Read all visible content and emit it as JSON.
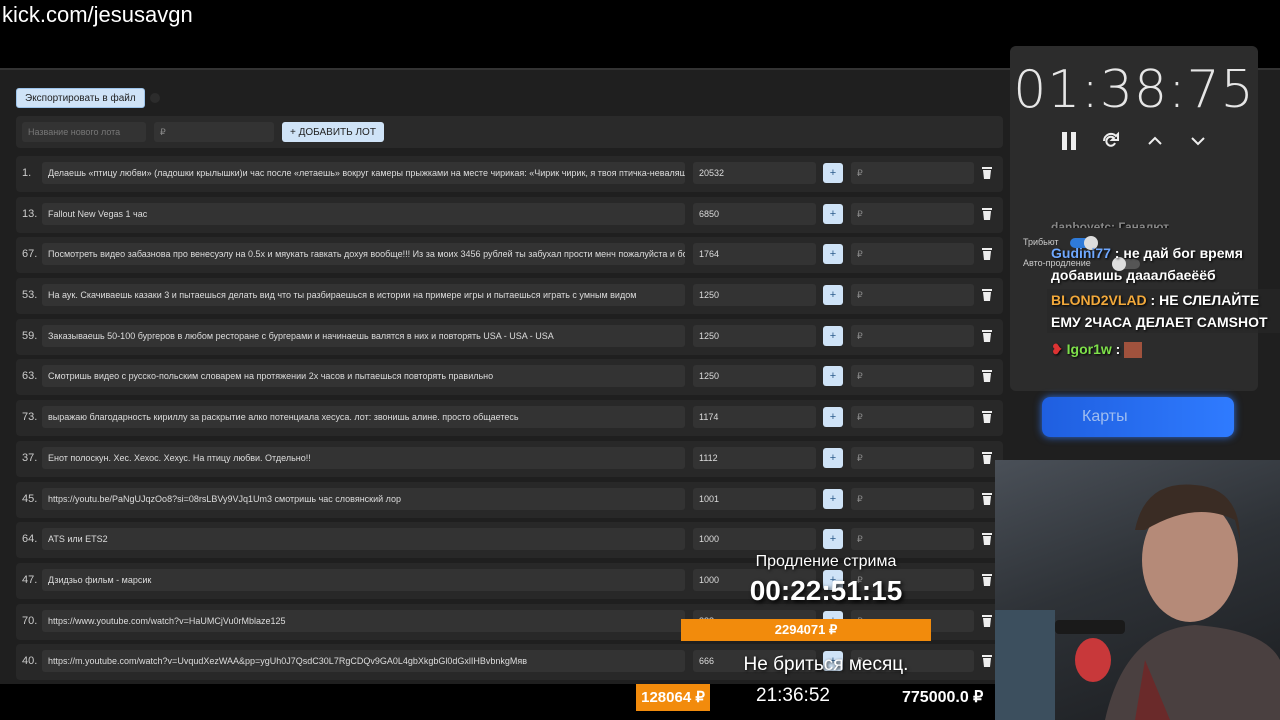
{
  "browser": {
    "url": "kick.com/jesusavgn"
  },
  "toolbar": {
    "export_label": "Экспортировать в файл"
  },
  "add_lot": {
    "name_placeholder": "Название нового лота",
    "price_placeholder": "₽",
    "add_label": "+ ДОБАВИТЬ ЛОТ"
  },
  "lots": [
    {
      "num": "1.",
      "name": "Делаешь «птицу любви» (ладошки крылышки)и час после «летаешь» вокруг камеры прыжками на месте чирикая: «Чирик чирик, я твоя птичка-неваляшка",
      "amount": "20532",
      "plus": "+",
      "rub": "₽"
    },
    {
      "num": "13.",
      "name": "Fallout New Vegas 1 час",
      "amount": "6850",
      "plus": "+",
      "rub": "₽"
    },
    {
      "num": "67.",
      "name": "Посмотреть видео забазнова про венесуэлу на 0.5x и мяукать гавкать дохуя вообще!!! Из за моих 3456 рублей ты забухал прости менч пожалуйста и бо",
      "amount": "1764",
      "plus": "+",
      "rub": "₽"
    },
    {
      "num": "53.",
      "name": "На аук. Скачиваешь казаки 3 и пытаешься делать вид что ты разбираешься в истории на примере игры и пытаешься играть с умным видом",
      "amount": "1250",
      "plus": "+",
      "rub": "₽"
    },
    {
      "num": "59.",
      "name": "Заказываешь 50-100 бургеров в любом ресторане с бургерами и начинаешь валятся в них и повторять USA - USA - USA",
      "amount": "1250",
      "plus": "+",
      "rub": "₽"
    },
    {
      "num": "63.",
      "name": "Смотришь видео с русско-польским словарем на протяжении 2х часов и пытаешься повторять правильно",
      "amount": "1250",
      "plus": "+",
      "rub": "₽"
    },
    {
      "num": "73.",
      "name": "выражаю благодарность кириллу за раскрытие алко потенциала хесуса. лот: звонишь алине. просто общаетесь",
      "amount": "1174",
      "plus": "+",
      "rub": "₽"
    },
    {
      "num": "37.",
      "name": "Енот полоскун. Хес. Хехос. Хехус. На птицу любви. Отдельно!!",
      "amount": "1112",
      "plus": "+",
      "rub": "₽"
    },
    {
      "num": "45.",
      "name": "https://youtu.be/PaNgUJqzOo8?si=08rsLBVy9VJq1Um3 смотришь час словянский лор",
      "amount": "1001",
      "plus": "+",
      "rub": "₽"
    },
    {
      "num": "64.",
      "name": "ATS или ETS2",
      "amount": "1000",
      "plus": "+",
      "rub": "₽"
    },
    {
      "num": "47.",
      "name": "Дзидзьо фильм - марсик",
      "amount": "1000",
      "plus": "+",
      "rub": "₽"
    },
    {
      "num": "70.",
      "name": "https://www.youtube.com/watch?v=HaUMCjVu0rMblaze125",
      "amount": "888",
      "plus": "+",
      "rub": "₽"
    },
    {
      "num": "40.",
      "name": "https://m.youtube.com/watch?v=UvqudXezWAA&pp=ygUh0J7QsdC30L7RgCDQv9GA0L4gbXkgbGl0dGxlIHBvbnkgMяв",
      "amount": "666",
      "plus": "+",
      "rub": "₽"
    }
  ],
  "timer": {
    "value": "01:38:75"
  },
  "toggles": {
    "tribute_label": "Трибьют",
    "auto_label": "Авто-продление"
  },
  "chat": {
    "top_partial": "danboyetc: Ганалют",
    "messages": [
      {
        "user": "Gudini77",
        "text": "не дай бог время добавишь даaалбаеёёб",
        "color": "#6fa8ff"
      },
      {
        "user": "BLOND2VLAD",
        "text": "НЕ СЛЕЛАЙТЕ ЕМУ 2ЧАСА ДЕЛАЕТ CAMSHOT",
        "color": "#f2a93b"
      },
      {
        "user": "Igor1w",
        "text": "",
        "color": "#7ee04a"
      }
    ]
  },
  "cards_button": {
    "label": "Карты"
  },
  "overlay": {
    "extension_label": "Продление стрима",
    "extension_timer": "00:22:51:15",
    "goal": "2294071 ₽",
    "subtitle": "Не бриться месяц.",
    "bottom_amount": "128064 ₽",
    "bottom_time": "21:36:52",
    "bottom_total": "775000.0 ₽"
  },
  "colors": {
    "accent": "#cfe3f7",
    "orange": "#f28b0c",
    "blue_button": "#2f7bff"
  }
}
